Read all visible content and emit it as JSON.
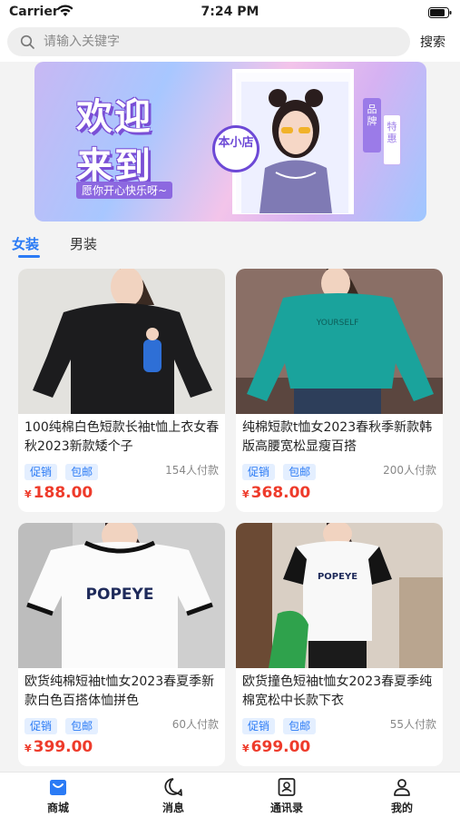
{
  "status_bar": {
    "carrier": "Carrier",
    "time": "7:24 PM"
  },
  "search": {
    "placeholder": "请输入关键字",
    "button_label": "搜索"
  },
  "banner": {
    "title_line1": "欢迎",
    "title_line2": "来到",
    "subtitle": "愿你开心快乐呀~",
    "badge": "本小店",
    "tag1": "品牌",
    "tag2": "特惠"
  },
  "tabs": [
    {
      "label": "女装",
      "active": true
    },
    {
      "label": "男装",
      "active": false
    }
  ],
  "products": [
    {
      "title": "100纯棉白色短款长袖t恤上衣女春秋2023新款矮个子",
      "tags": [
        "促销",
        "包邮"
      ],
      "paid": "154人付款",
      "currency": "¥",
      "price": "188.00",
      "image": "black-longsleeve-shirt"
    },
    {
      "title": "纯棉短款t恤女2023春秋季新款韩版高腰宽松显瘦百搭",
      "tags": [
        "促销",
        "包邮"
      ],
      "paid": "200人付款",
      "currency": "¥",
      "price": "368.00",
      "image": "teal-longsleeve-shirt"
    },
    {
      "title": "欧货纯棉短袖t恤女2023春夏季新款白色百搭体恤拼色",
      "tags": [
        "促销",
        "包邮"
      ],
      "paid": "60人付款",
      "currency": "¥",
      "price": "399.00",
      "image": "white-popeye-tshirt"
    },
    {
      "title": "欧货撞色短袖t恤女2023春夏季纯棉宽松中长款下衣",
      "tags": [
        "促销",
        "包邮"
      ],
      "paid": "55人付款",
      "currency": "¥",
      "price": "699.00",
      "image": "raglan-popeye-tshirt"
    }
  ],
  "bottom_nav": [
    {
      "label": "商城",
      "icon": "shop-bag-icon",
      "active": true
    },
    {
      "label": "消息",
      "icon": "chat-bubble-icon",
      "active": false
    },
    {
      "label": "通讯录",
      "icon": "contacts-icon",
      "active": false
    },
    {
      "label": "我的",
      "icon": "person-icon",
      "active": false
    }
  ],
  "colors": {
    "accent": "#2b7bf5",
    "price": "#ee3b2b",
    "tag_bg": "#e4efff"
  }
}
